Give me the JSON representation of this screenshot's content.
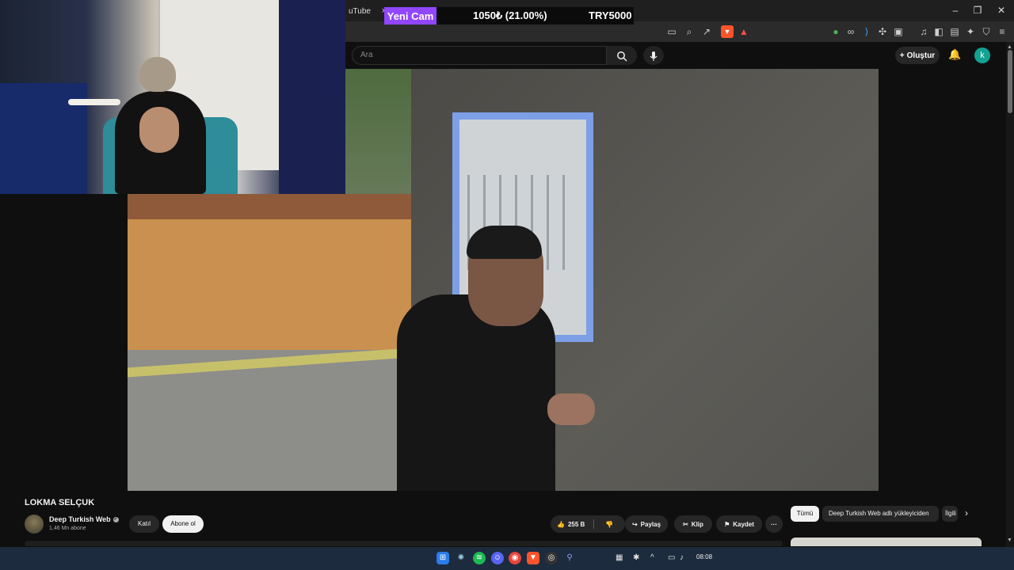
{
  "browser": {
    "tab_title": "uTube",
    "tab_close": "×",
    "window_controls": {
      "minimize": "–",
      "maximize": "❐",
      "close": "✕"
    }
  },
  "donation": {
    "name": "Yeni Cam",
    "amount": "1050₺ (21.00%)",
    "goal": "TRY5000",
    "accent": "#9146ff"
  },
  "youtube": {
    "search_placeholder": "Ara",
    "create_label": "Oluştur",
    "avatar_letter": "k",
    "avatar_color": "#12a392"
  },
  "video": {
    "title": "LOKMA SELÇUK",
    "channel": "Deep Turkish Web",
    "subscribers": "1,46 Mn abone",
    "join_label": "Katıl",
    "subscribe_label": "Abone ol",
    "likes": "255 B",
    "share_label": "Paylaş",
    "clip_label": "Klip",
    "save_label": "Kaydet",
    "more_label": "···"
  },
  "recommendation_chips": {
    "all": "Tümü",
    "from_uploader": "Deep Turkish Web adlı yükleyiciden",
    "related": "İlgili",
    "next": "›"
  },
  "taskbar": {
    "time": "08:08"
  }
}
